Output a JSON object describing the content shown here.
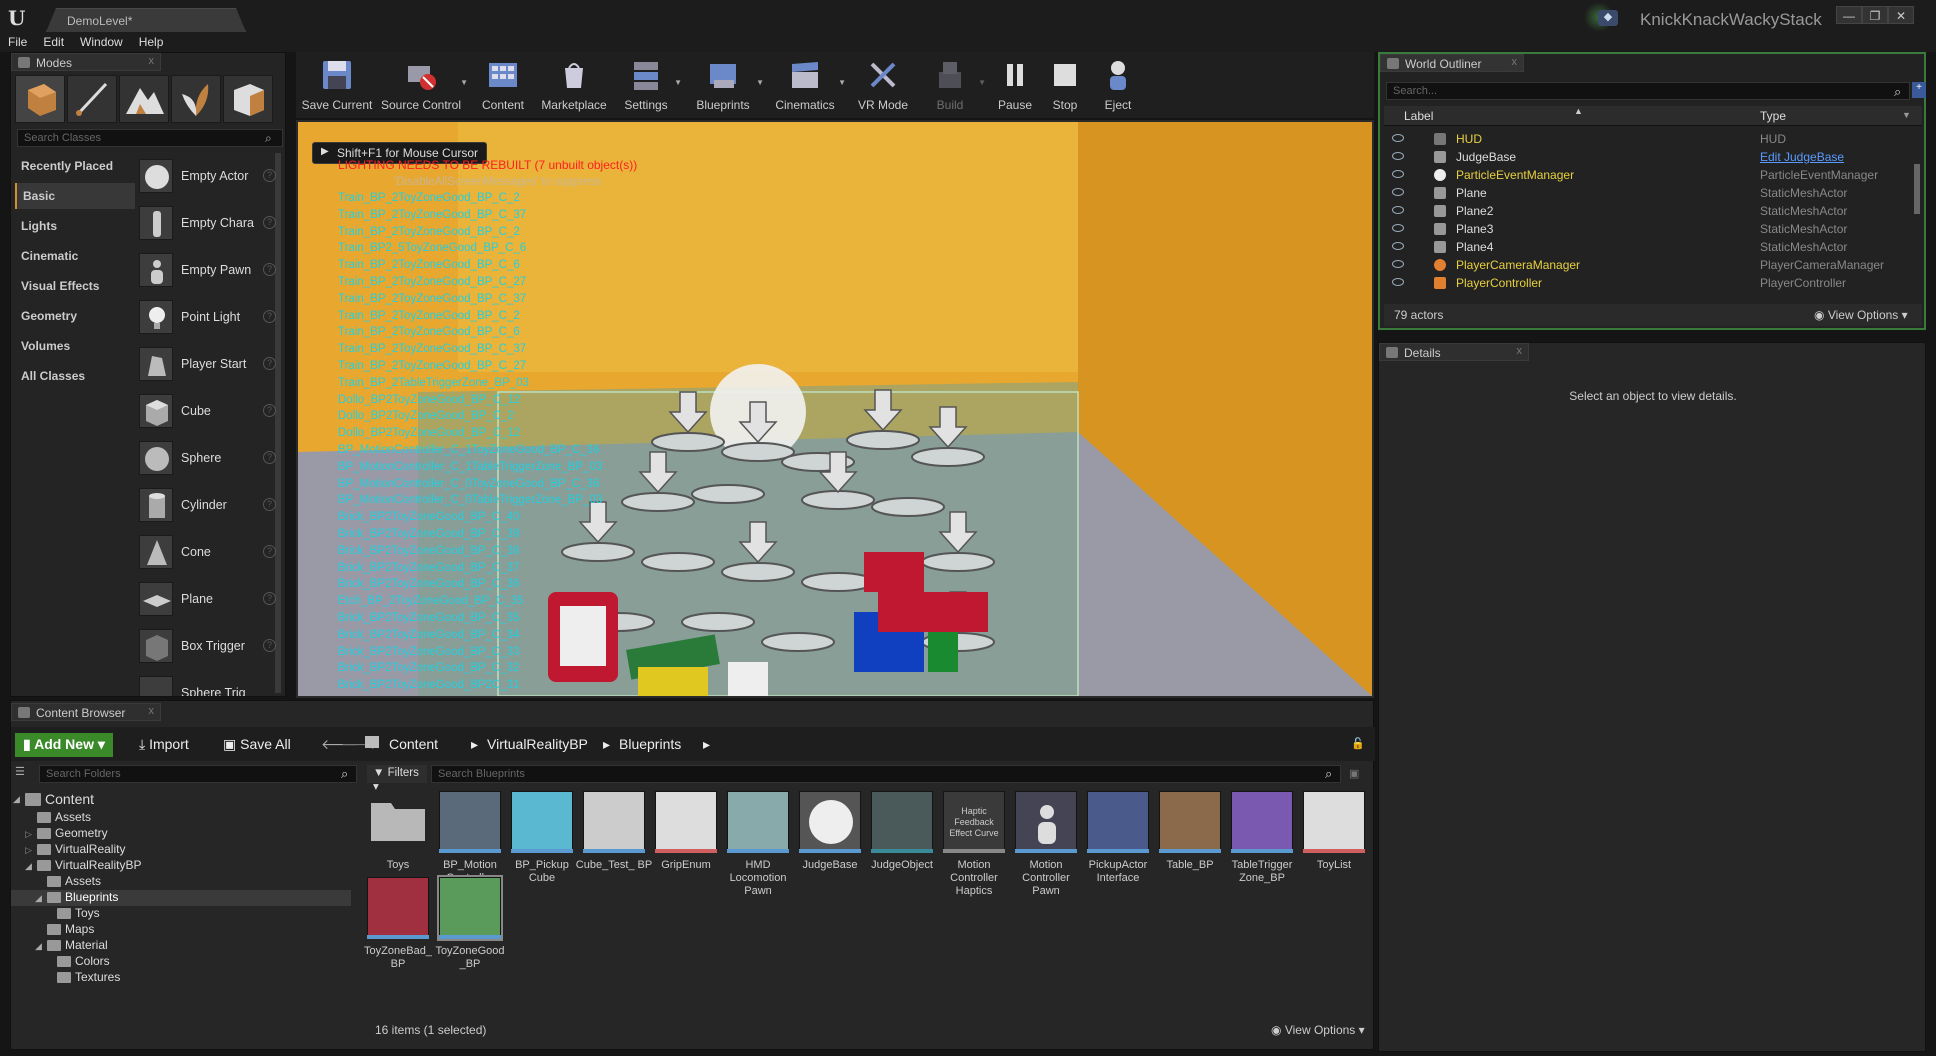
{
  "window": {
    "level_tab": "DemoLevel*",
    "project": "KnickKnackWackyStack"
  },
  "menu": [
    "File",
    "Edit",
    "Window",
    "Help"
  ],
  "modes": {
    "tab": "Modes",
    "search_placeholder": "Search Classes",
    "categories": [
      "Recently Placed",
      "Basic",
      "Lights",
      "Cinematic",
      "Visual Effects",
      "Geometry",
      "Volumes",
      "All Classes"
    ],
    "selected_category": "Basic",
    "items": [
      "Empty Actor",
      "Empty Chara",
      "Empty Pawn",
      "Point Light",
      "Player Start",
      "Cube",
      "Sphere",
      "Cylinder",
      "Cone",
      "Plane",
      "Box Trigger",
      "Sphere Trig"
    ]
  },
  "toolbar": [
    "Save Current",
    "Source Control",
    "Content",
    "Marketplace",
    "Settings",
    "Blueprints",
    "Cinematics",
    "VR Mode",
    "Build",
    "Pause",
    "Stop",
    "Eject"
  ],
  "viewport": {
    "hint": "Shift+F1 for Mouse Cursor",
    "warning": "LIGHTING NEEDS TO BE REBUILT (7 unbuilt object(s))",
    "suppress": "'DisableAllScreenMessages' to suppress",
    "debug_lines": [
      "Train_BP_2ToyZoneGood_BP_C_2",
      "Train_BP_2ToyZoneGood_BP_C_37",
      "Train_BP_2ToyZoneGood_BP_C_2",
      "Train_BP2_5ToyZoneGood_BP_C_6",
      "Train_BP_2ToyZoneGood_BP_C_6",
      "Train_BP_2ToyZoneGood_BP_C_27",
      "Train_BP_2ToyZoneGood_BP_C_37",
      "Train_BP_2ToyZoneGood_BP_C_2",
      "Train_BP_2ToyZoneGood_BP_C_6",
      "Train_BP_2ToyZoneGood_BP_C_37",
      "Train_BP_2ToyZoneGood_BP_C_27",
      "Train_BP_2TableTriggerZone_BP_03",
      "Dollo_BP2ToyZoneGood_BP_C_12",
      "Dollo_BP2ToyZoneGood_BP_C_2",
      "Dollo_BP2ToyZoneGood_BP_C_12",
      "BP_MotionController_C_1ToyZoneGood_BP_C_36",
      "BP_MotionController_C_1TableTriggerZone_BP_03",
      "BP_MotionController_C_0ToyZoneGood_BP_C_36",
      "BP_MotionController_C_0TableTriggerZone_BP_03",
      "Brick_BP2ToyZoneGood_BP_C_40",
      "Brick_BP2ToyZoneGood_BP_C_39",
      "Brick_BP2ToyZoneGood_BP_C_38",
      "Brick_BP2ToyZoneGood_BP_C_37",
      "Brick_BP2ToyZoneGood_BP_C_36",
      "Etch_BP_2ToyZoneGood_BP_C_35",
      "Brick_BP2ToyZoneGood_BP_C_35",
      "Brick_BP2ToyZoneGood_BP_C_34",
      "Brick_BP2ToyZoneGood_BP_C_33",
      "Brick_BP2ToyZoneGood_BP_C_32",
      "Brick_BP2ToyZoneGood_BP2C_31"
    ]
  },
  "outliner": {
    "tab": "World Outliner",
    "search_placeholder": "Search...",
    "col_label": "Label",
    "col_type": "Type",
    "rows": [
      {
        "label": "HUD",
        "type": "HUD"
      },
      {
        "label": "JudgeBase",
        "type": "Edit JudgeBase"
      },
      {
        "label": "ParticleEventManager",
        "type": "ParticleEventManager"
      },
      {
        "label": "Plane",
        "type": "StaticMeshActor"
      },
      {
        "label": "Plane2",
        "type": "StaticMeshActor"
      },
      {
        "label": "Plane3",
        "type": "StaticMeshActor"
      },
      {
        "label": "Plane4",
        "type": "StaticMeshActor"
      },
      {
        "label": "PlayerCameraManager",
        "type": "PlayerCameraManager"
      },
      {
        "label": "PlayerController",
        "type": "PlayerController"
      }
    ],
    "count": "79 actors",
    "view_options": "View Options"
  },
  "details": {
    "tab": "Details",
    "message": "Select an object to view details."
  },
  "content_browser": {
    "tab": "Content Browser",
    "add_new": "Add New",
    "import": "Import",
    "save_all": "Save All",
    "breadcrumb": [
      "Content",
      "VirtualRealityBP",
      "Blueprints"
    ],
    "folder_search": "Search Folders",
    "filters": "Filters",
    "asset_search": "Search Blueprints",
    "tree": [
      "Content",
      "Assets",
      "Geometry",
      "VirtualReality",
      "VirtualRealityBP",
      "Assets",
      "Blueprints",
      "Toys",
      "Maps",
      "Material",
      "Colors",
      "Textures"
    ],
    "assets": [
      "Toys",
      "BP_Motion Controller",
      "BP_Pickup Cube",
      "Cube_Test_ BP",
      "GripEnum",
      "HMD Locomotion Pawn",
      "JudgeBase",
      "JudgeObject",
      "Motion Controller Haptics",
      "Motion Controller Pawn",
      "PickupActor Interface",
      "Table_BP",
      "TableTrigger Zone_BP",
      "ToyList",
      "ToyZoneBad_ BP",
      "ToyZoneGood _BP"
    ],
    "haptic_label": "Haptic Feedback Effect Curve",
    "status": "16 items (1 selected)",
    "view_options": "View Options"
  }
}
